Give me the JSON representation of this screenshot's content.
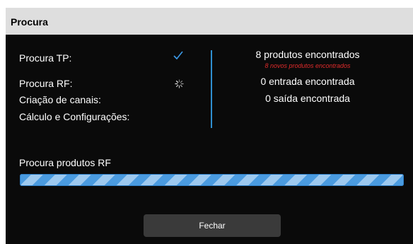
{
  "dialog": {
    "title": "Procura",
    "rows": {
      "tp_label": "Procura TP:",
      "rf_label": "Procura RF:",
      "channels_label": "Criação de canais:",
      "config_label": "Cálculo e Configurações:"
    },
    "status": {
      "tp_icon": "checkmark-icon",
      "rf_icon": "spinner-icon"
    },
    "results": {
      "products_found": "8 produtos encontrados",
      "new_products": "8 novos produtos encontrados",
      "inputs_found": "0 entrada encontrada",
      "outputs_found": "0 saída encontrada"
    },
    "progress": {
      "label": "Procura produtos RF",
      "value": 1.0
    },
    "close_button": "Fechar"
  },
  "colors": {
    "background": "#0a0a0a",
    "titlebar": "#dedede",
    "accent": "#2f8fd0",
    "warning_text": "#e02b2b",
    "button": "#3a3a3a"
  }
}
